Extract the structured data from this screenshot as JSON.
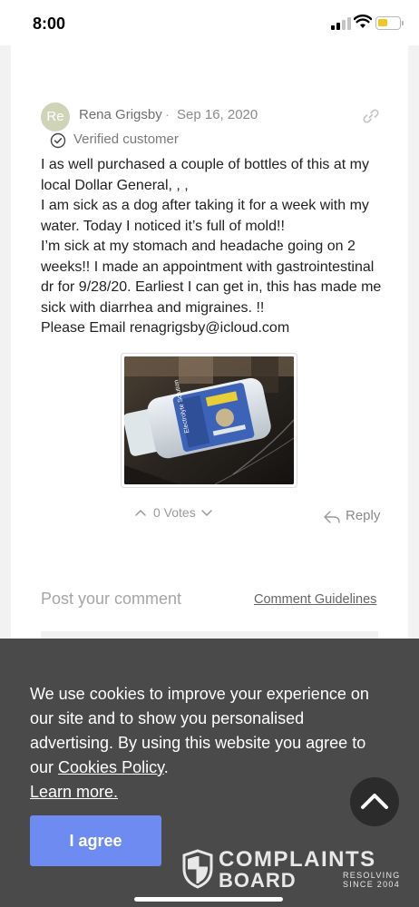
{
  "status_bar": {
    "time": "8:00",
    "battery_level": 0.45,
    "icons": [
      "cellular-signal-icon",
      "wifi-icon",
      "battery-icon"
    ]
  },
  "review": {
    "avatar_initials": "Re",
    "author": "Rena Grigsby",
    "separator": "·",
    "date": "Sep 16, 2020",
    "verified_label": "Verified customer",
    "body_lines": [
      "I as well purchased a couple of bottles of this at my",
      "local Dollar General, , ,",
      "I am sick as a dog after taking it for a week with my",
      "water. Today I noticed it’s full of mold!!",
      "I’m sick at my stomach and headache going on 2",
      "weeks!! I made an appointment with gastrointestinal",
      "dr for 9/28/20. Earliest I can get in, this has made me",
      "sick with diarrhea and migraines. !!",
      "Please Email renagrigsby@icloud.com"
    ],
    "photo_label": "Electrolyte Solution",
    "votes_label": "0 Votes",
    "reply_label": "Reply"
  },
  "comment": {
    "placeholder_title": "Post your comment",
    "guidelines_link": "Comment Guidelines"
  },
  "cookie_banner": {
    "line1": "We use cookies to improve your experience on",
    "line2": "our site and to show you personalised",
    "line3": "advertising. By using this website you agree to",
    "line4_prefix": "our ",
    "policy_link": "Cookies Policy",
    "line4_suffix": ".",
    "learn_more": "Learn more.",
    "agree_button": "I agree"
  },
  "brand": {
    "name_line1": "COMPLAINTS",
    "name_line2": "BOARD",
    "tagline_line1": "RESOLVING",
    "tagline_line2": "SINCE 2004"
  },
  "colors": {
    "accent": "#6d8bf0",
    "banner_bg": "#4a4a4a",
    "avatar_bg": "#cfd4b8",
    "battery_fill": "#f3c623"
  }
}
